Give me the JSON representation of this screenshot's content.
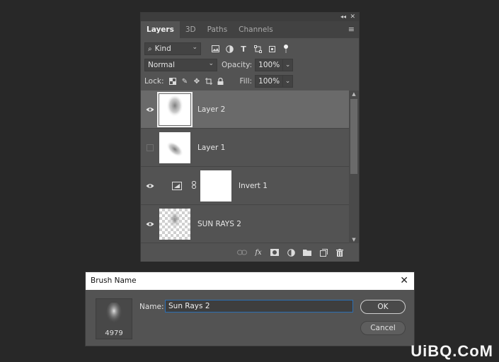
{
  "panel": {
    "collapse_glyph": "◂◂",
    "close_glyph": "✕",
    "menu_glyph": "≡",
    "tabs": [
      {
        "label": "Layers",
        "active": true
      },
      {
        "label": "3D",
        "active": false
      },
      {
        "label": "Paths",
        "active": false
      },
      {
        "label": "Channels",
        "active": false
      }
    ],
    "filter": {
      "value": "Kind",
      "icons": [
        "image-filter-icon",
        "adjustment-filter-icon",
        "type-filter-icon",
        "shape-filter-icon",
        "smart-object-filter-icon",
        "filter-toggle-icon"
      ]
    },
    "blend_mode": "Normal",
    "opacity_label": "Opacity:",
    "opacity_value": "100%",
    "lock_label": "Lock:",
    "fill_label": "Fill:",
    "fill_value": "100%",
    "layers": [
      {
        "name": "Layer 2",
        "visible": true,
        "selected": true
      },
      {
        "name": "Layer 1",
        "visible": false,
        "selected": false
      },
      {
        "name": "Invert 1",
        "visible": true,
        "selected": false
      },
      {
        "name": "SUN RAYS 2",
        "visible": true,
        "selected": false
      }
    ],
    "footer_icons": [
      "link-layers-icon",
      "fx-icon",
      "add-mask-icon",
      "new-adjustment-icon",
      "new-group-icon",
      "new-layer-icon",
      "delete-layer-icon"
    ],
    "fx_label": "fx"
  },
  "dialog": {
    "title": "Brush Name",
    "close_glyph": "✕",
    "preview_count": "4979",
    "name_label": "Name:",
    "name_value": "Sun Rays 2",
    "ok_label": "OK",
    "cancel_label": "Cancel"
  },
  "watermark": "UiBQ.CoM",
  "colors": {
    "background": "#282828",
    "panel": "#535353",
    "selected_layer": "#6a6a6a",
    "focus_border": "#2d6fb2"
  }
}
